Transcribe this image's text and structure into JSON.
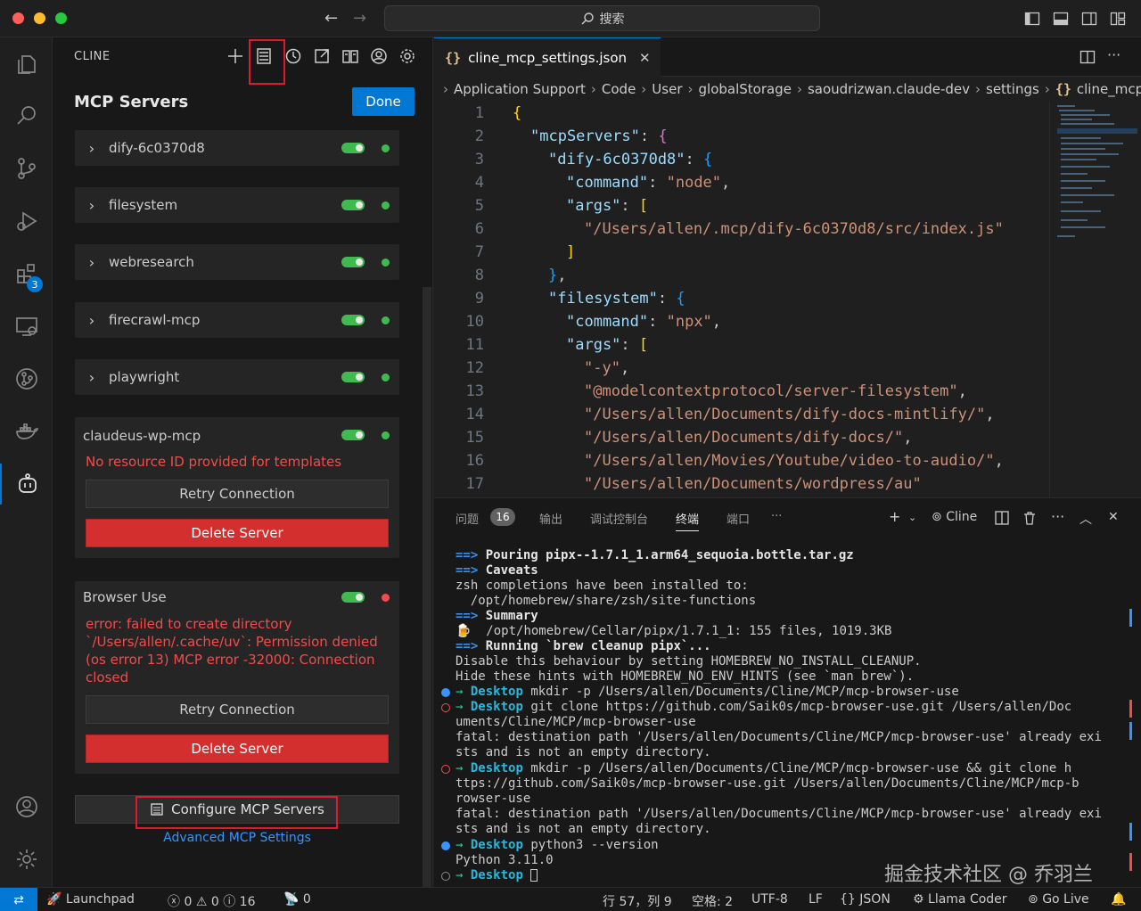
{
  "window": {
    "search_placeholder": "搜索",
    "colors": {
      "close": "#ff5f57",
      "minimize": "#febc2e",
      "maximize": "#28c840",
      "accent": "#0078d4"
    }
  },
  "activity_bar": {
    "items": [
      "explorer-icon",
      "search-icon",
      "source-control-icon",
      "run-debug-icon",
      "extensions-icon",
      "remote-explorer-icon",
      "git-graph-icon",
      "docker-icon",
      "cline-icon"
    ],
    "extensions_badge": "3",
    "bottom": [
      "account-icon",
      "settings-gear-icon"
    ]
  },
  "sidebar": {
    "title": "CLINE",
    "heading": "MCP Servers",
    "done_label": "Done",
    "servers": [
      {
        "name": "dify-6c0370d8",
        "status": "green"
      },
      {
        "name": "filesystem",
        "status": "green"
      },
      {
        "name": "webresearch",
        "status": "green"
      },
      {
        "name": "firecrawl-mcp",
        "status": "green"
      },
      {
        "name": "playwright",
        "status": "green"
      }
    ],
    "card1": {
      "name": "claudeus-wp-mcp",
      "error": "No resource ID provided for templates",
      "retry": "Retry Connection",
      "delete": "Delete Server"
    },
    "card2": {
      "name": "Browser Use",
      "error": "error: failed to create directory `/Users/allen/.cache/uv`: Permission denied (os error 13) MCP error -32000: Connection closed",
      "retry": "Retry Connection",
      "delete": "Delete Server"
    },
    "configure_label": "Configure MCP Servers",
    "advanced_label": "Advanced MCP Settings",
    "status_colors": {
      "green": "#3fb950",
      "red": "#f14c4c"
    }
  },
  "editor": {
    "tab_label": "cline_mcp_settings.json",
    "breadcrumb": [
      "Application Support",
      "Code",
      "User",
      "globalStorage",
      "saoudrizwan.claude-dev",
      "settings",
      "cline_mcp"
    ],
    "line_numbers": [
      "1",
      "2",
      "3",
      "4",
      "5",
      "6",
      "7",
      "8",
      "9",
      "10",
      "11",
      "12",
      "13",
      "14",
      "15",
      "16",
      "17"
    ],
    "code": {
      "l1": "{",
      "l2k": "\"mcpServers\"",
      "l2p": ": ",
      "l2b": "{",
      "l3k": "\"dify-6c0370d8\"",
      "l3p": ": ",
      "l3b": "{",
      "l4k": "\"command\"",
      "l4p": ": ",
      "l4s": "\"node\"",
      "l4e": ",",
      "l5k": "\"args\"",
      "l5p": ": ",
      "l5b": "[",
      "l6s": "\"/Users/allen/.mcp/dify-6c0370d8/src/index.js\"",
      "l7b": "]",
      "l8b": "}",
      "l8e": ",",
      "l9k": "\"filesystem\"",
      "l9p": ": ",
      "l9b": "{",
      "l10k": "\"command\"",
      "l10p": ": ",
      "l10s": "\"npx\"",
      "l10e": ",",
      "l11k": "\"args\"",
      "l11p": ": ",
      "l11b": "[",
      "l12s": "\"-y\"",
      "l12e": ",",
      "l13s": "\"@modelcontextprotocol/server-filesystem\"",
      "l13e": ",",
      "l14s": "\"/Users/allen/Documents/dify-docs-mintlify/\"",
      "l14e": ",",
      "l15s": "\"/Users/allen/Documents/dify-docs/\"",
      "l15e": ",",
      "l16s": "\"/Users/allen/Movies/Youtube/video-to-audio/\"",
      "l16e": ",",
      "l17s": "\"/Users/allen/Documents/wordpress/au\""
    }
  },
  "panel": {
    "tabs": [
      "问题",
      "输出",
      "调试控制台",
      "终端",
      "端口",
      "···"
    ],
    "problems_count": "16",
    "terminal_label": "Cline",
    "terminal": {
      "t1a": "==>",
      "t1b": " Pouring pipx--1.7.1_1.arm64_sequoia.bottle.tar.gz",
      "t2a": "==>",
      "t2b": " Caveats",
      "t3": "zsh completions have been installed to:",
      "t4": "  /opt/homebrew/share/zsh/site-functions",
      "t5a": "==>",
      "t5b": " Summary",
      "t6a": "🍺",
      "t6b": "  /opt/homebrew/Cellar/pipx/1.7.1_1: 155 files, 1019.3KB",
      "t7a": "==>",
      "t7b": " Running `brew cleanup pipx`...",
      "t8": "Disable this behaviour by setting HOMEBREW_NO_INSTALL_CLEANUP.",
      "t9": "Hide these hints with HOMEBREW_NO_ENV_HINTS (see `man brew`).",
      "arrow": "→",
      "prompt": "Desktop",
      "t10": " mkdir -p /Users/allen/Documents/Cline/MCP/mcp-browser-use",
      "t11": " git clone https://github.com/Saik0s/mcp-browser-use.git /Users/allen/Doc",
      "t12": "uments/Cline/MCP/mcp-browser-use",
      "t13": "fatal: destination path '/Users/allen/Documents/Cline/MCP/mcp-browser-use' already exi",
      "t14": "sts and is not an empty directory.",
      "t15": " mkdir -p /Users/allen/Documents/Cline/MCP/mcp-browser-use && git clone h",
      "t16": "ttps://github.com/Saik0s/mcp-browser-use.git /Users/allen/Documents/Cline/MCP/mcp-b",
      "t17": "rowser-use",
      "t18": "fatal: destination path '/Users/allen/Documents/Cline/MCP/mcp-browser-use' already exi",
      "t19": "sts and is not an empty directory.",
      "t20": " python3 --version",
      "t21": "Python 3.11.0"
    },
    "watermark": "掘金技术社区 @ 乔羽兰"
  },
  "statusbar": {
    "launchpad": "Launchpad",
    "errors": "0",
    "warnings": "0",
    "infos": "16",
    "ports": "0",
    "position": "行 57，列 9",
    "spaces": "空格: 2",
    "encoding": "UTF-8",
    "eol": "LF",
    "language": "JSON",
    "llama": "Llama Coder",
    "golive": "Go Live"
  }
}
